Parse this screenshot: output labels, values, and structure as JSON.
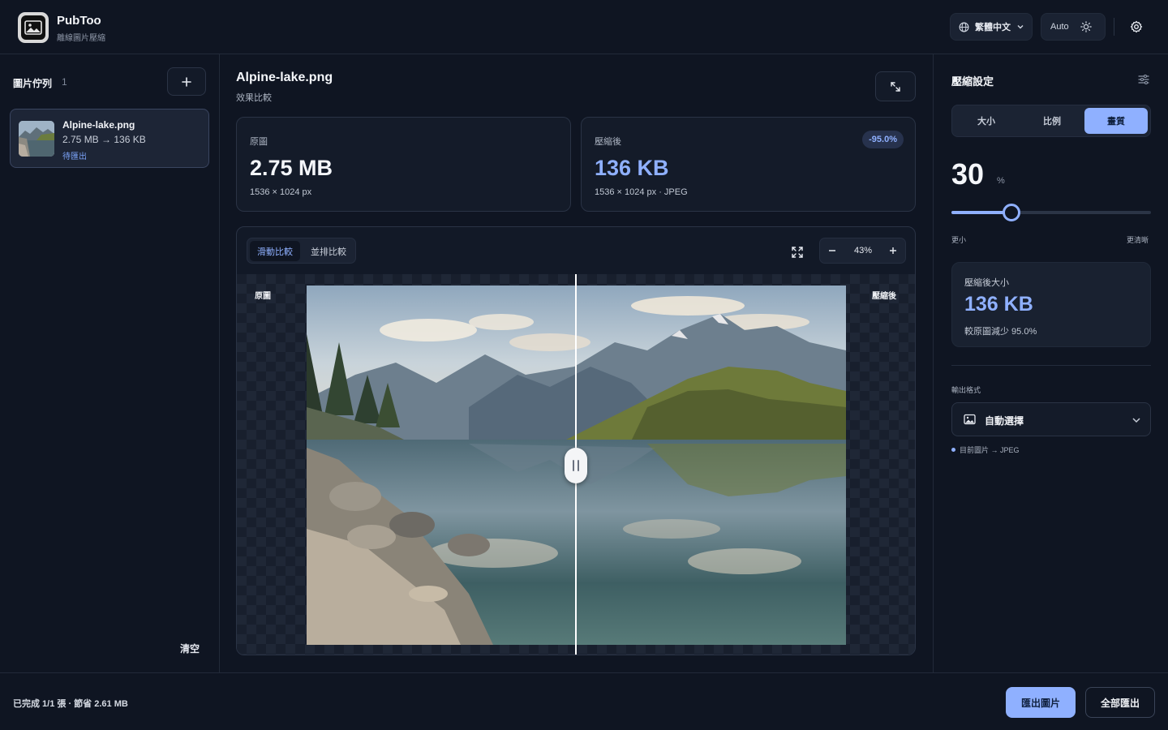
{
  "header": {
    "app_name": "PubToo",
    "app_subtitle": "離線圖片壓縮",
    "language": "繁體中文",
    "theme_mode": "Auto"
  },
  "sidebar": {
    "title": "圖片佇列",
    "count": "1",
    "files": [
      {
        "name": "Alpine-lake.png",
        "sizes": "2.75 MB → 136 KB",
        "status": "待匯出"
      }
    ],
    "clear_label": "清空"
  },
  "main": {
    "title": "Alpine-lake.png",
    "subtitle": "效果比較",
    "original": {
      "label": "原圖",
      "size": "2.75 MB",
      "meta": "1536 × 1024 px"
    },
    "compressed": {
      "label": "壓縮後",
      "size": "136 KB",
      "meta": "1536 × 1024 px · JPEG",
      "badge": "-95.0%"
    },
    "compare": {
      "tabs": [
        "滑動比較",
        "並排比較"
      ],
      "active_tab": 0,
      "zoom": "43%",
      "label_left": "原圖",
      "label_right": "壓縮後",
      "split_position": 0.5
    }
  },
  "settings": {
    "title": "壓縮設定",
    "modes": [
      "大小",
      "比例",
      "畫質"
    ],
    "active_mode": 2,
    "quality_value": "30",
    "quality_unit": "%",
    "quality_fraction": 0.3,
    "slider_min_label": "更小",
    "slider_max_label": "更清晰",
    "result_label": "壓縮後大小",
    "result_size": "136 KB",
    "result_note": "較原圖減少 95.0%",
    "format_label": "輸出格式",
    "format_value": "自動選擇",
    "format_note": "目前圖片 → JPEG"
  },
  "footer": {
    "status": "已完成 1/1 張 · 節省 2.61 MB",
    "export_label": "匯出圖片",
    "export_all_label": "全部匯出"
  },
  "colors": {
    "accent": "#8fb0ff",
    "background": "#0f1522",
    "panel": "#141b29"
  }
}
